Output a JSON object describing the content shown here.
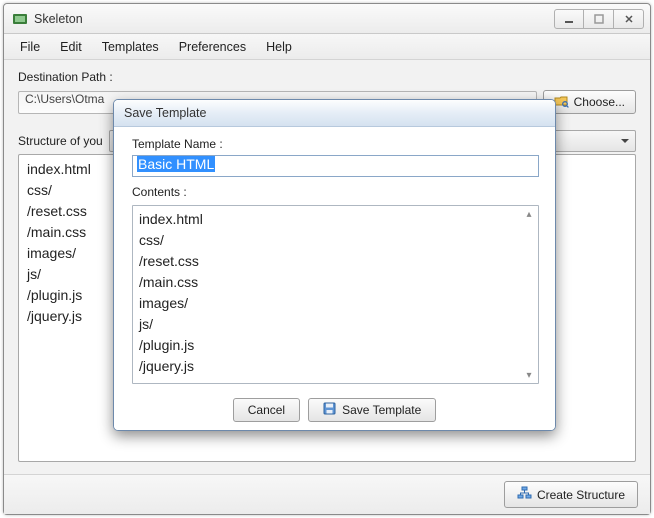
{
  "window": {
    "title": "Skeleton",
    "menus": [
      "File",
      "Edit",
      "Templates",
      "Preferences",
      "Help"
    ],
    "dest_label": "Destination Path :",
    "dest_value": "C:\\Users\\Otma",
    "choose_label": "Choose...",
    "structure_label": "Structure of you",
    "structure_items": [
      "index.html",
      "css/",
      "/reset.css",
      "/main.css",
      "images/",
      "js/",
      "/plugin.js",
      "/jquery.js"
    ],
    "create_button": "Create Structure"
  },
  "dialog": {
    "title": "Save Template",
    "name_label": "Template Name :",
    "name_value": "Basic HTML",
    "contents_label": "Contents :",
    "contents_items": [
      "index.html",
      "css/",
      "/reset.css",
      "/main.css",
      "images/",
      "js/",
      "/plugin.js",
      "/jquery.js"
    ],
    "cancel": "Cancel",
    "save": "Save Template"
  }
}
